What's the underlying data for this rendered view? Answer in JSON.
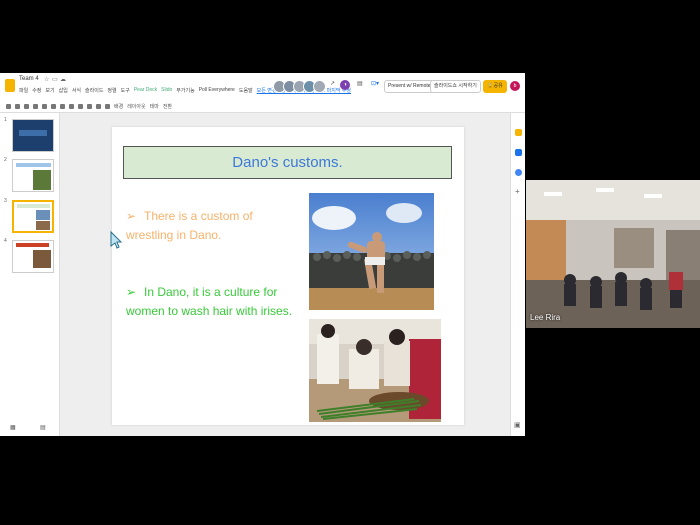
{
  "window": {
    "doc_title": "Team 4",
    "menu": [
      "파일",
      "수정",
      "보기",
      "삽입",
      "서식",
      "슬라이드",
      "정렬",
      "도구",
      "Pear Deck",
      "Slido",
      "부가기능",
      "Poll Everywhere",
      "도움말"
    ],
    "save_status": "모든 변경사항이 저장되었습니다. 마지막 수정",
    "present_label": "Present w/ Remote",
    "present_option": "슬라이드쇼 시작하기",
    "share_label": "공유",
    "profile_initial": "b"
  },
  "toolbar": {
    "items": [
      "배경",
      "레이아웃",
      "테마",
      "전환"
    ]
  },
  "filmstrip": {
    "numbers": [
      "1",
      "2",
      "3",
      "4"
    ]
  },
  "slide": {
    "title": "Dano's customs.",
    "bullet_glyph": "➢",
    "bullets": [
      "There is a custom of wrestling in Dano.",
      "In Dano, it is a culture for women to wash hair with irises."
    ]
  },
  "video": {
    "participant_name": "Lee Rira"
  },
  "colors": {
    "title_bg": "#d9ead3",
    "title_text": "#3c78d8",
    "bullet1": "#f6b26b",
    "bullet2": "#38c93a",
    "accent": "#f4b400"
  }
}
